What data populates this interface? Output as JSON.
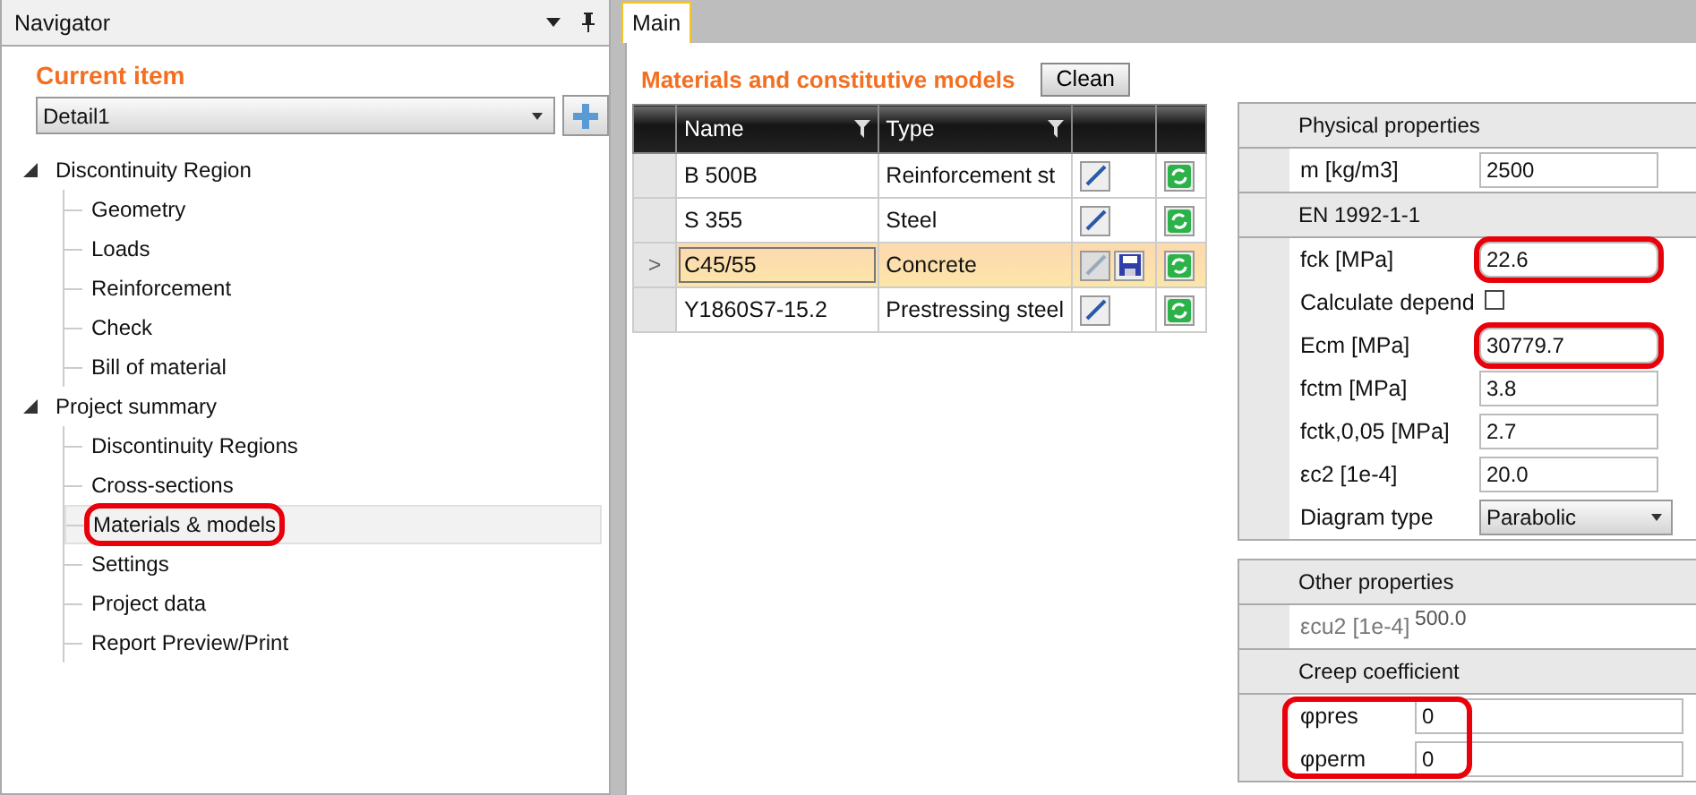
{
  "navigator": {
    "title": "Navigator",
    "current_item_label": "Current item",
    "current_item": "Detail1",
    "tree": [
      {
        "label": "Discontinuity Region",
        "expanded": true,
        "children": [
          {
            "label": "Geometry",
            "selected": false,
            "highlighted": false
          },
          {
            "label": "Loads",
            "selected": false,
            "highlighted": false
          },
          {
            "label": "Reinforcement",
            "selected": false,
            "highlighted": false
          },
          {
            "label": "Check",
            "selected": false,
            "highlighted": false
          },
          {
            "label": "Bill of material",
            "selected": false,
            "highlighted": false
          }
        ]
      },
      {
        "label": "Project summary",
        "expanded": true,
        "children": [
          {
            "label": "Discontinuity Regions",
            "selected": false,
            "highlighted": false
          },
          {
            "label": "Cross-sections",
            "selected": false,
            "highlighted": false
          },
          {
            "label": "Materials & models",
            "selected": true,
            "highlighted": true
          },
          {
            "label": "Settings",
            "selected": false,
            "highlighted": false
          },
          {
            "label": "Project data",
            "selected": false,
            "highlighted": false
          },
          {
            "label": "Report Preview/Print",
            "selected": false,
            "highlighted": false
          }
        ]
      }
    ]
  },
  "tabs": [
    {
      "label": "Main",
      "selected": true
    }
  ],
  "materials": {
    "title": "Materials and constitutive models",
    "clean_button": "Clean",
    "columns": [
      "Name",
      "Type"
    ],
    "rows": [
      {
        "name": "B 500B",
        "type": "Reinforcement st",
        "selected": false,
        "editing": false
      },
      {
        "name": "S 355",
        "type": "Steel",
        "selected": false,
        "editing": false
      },
      {
        "name": "C45/55",
        "type": "Concrete",
        "selected": true,
        "editing": true,
        "marker": ">"
      },
      {
        "name": "Y1860S7-15.2",
        "type": "Prestressing steel",
        "selected": false,
        "editing": false
      }
    ]
  },
  "property_panels": [
    {
      "groups": [
        {
          "title": "Physical properties",
          "highlighted": false,
          "rows": [
            {
              "kind": "field",
              "label": "m [kg/m3]",
              "value": "2500",
              "highlighted": false
            }
          ]
        },
        {
          "title": "EN 1992-1-1",
          "highlighted": false,
          "rows": [
            {
              "kind": "field",
              "label": "fck [MPa]",
              "value": "22.6",
              "highlighted": true
            },
            {
              "kind": "checkbox",
              "label": "Calculate depend",
              "checked": false
            },
            {
              "kind": "field",
              "label": "Ecm [MPa]",
              "value": "30779.7",
              "highlighted": true
            },
            {
              "kind": "field",
              "label": "fctm [MPa]",
              "value": "3.8",
              "highlighted": false
            },
            {
              "kind": "field",
              "label": "fctk,0,05 [MPa]",
              "value": "2.7",
              "highlighted": false
            },
            {
              "kind": "field",
              "label": "εc2 [1e-4]",
              "value": "20.0",
              "highlighted": false
            },
            {
              "kind": "dropdown",
              "label": "Diagram type",
              "value": "Parabolic"
            }
          ]
        }
      ]
    },
    {
      "groups": [
        {
          "title": "Other properties",
          "highlighted": false,
          "rows": [
            {
              "kind": "readonly",
              "label": "εcu2 [1e-4]",
              "value": "500.0"
            }
          ]
        },
        {
          "title": "Creep coefficient",
          "highlighted": true,
          "rows": [
            {
              "kind": "field",
              "label": "φpres",
              "value": "0",
              "highlighted": false
            },
            {
              "kind": "field",
              "label": "φperm",
              "value": "0",
              "highlighted": false
            }
          ]
        }
      ]
    }
  ]
}
